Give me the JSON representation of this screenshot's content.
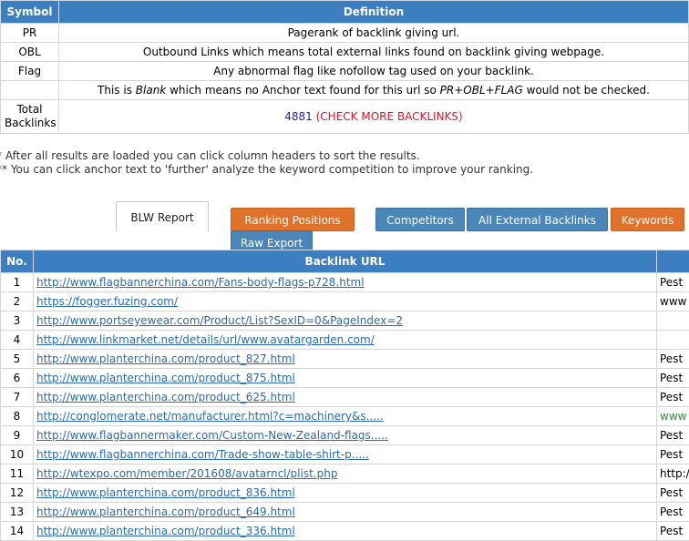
{
  "legend": {
    "headers": {
      "symbol": "Symbol",
      "definition": "Definition"
    },
    "rows": [
      {
        "symbol": "PR",
        "definition": "Pagerank of backlink giving url."
      },
      {
        "symbol": "OBL",
        "definition": "Outbound Links which means total external links found on backlink giving webpage."
      },
      {
        "symbol": "Flag",
        "definition": "Any abnormal flag like nofollow tag used on your backlink."
      }
    ],
    "blank_row": {
      "symbol": "",
      "pre": "This is ",
      "blank": "Blank",
      "mid": " which means no Anchor text found for this url so ",
      "formula": "PR+OBL+FLAG",
      "post": " would not be checked."
    },
    "total": {
      "label_line1": "Total",
      "label_line2": "Backlinks",
      "count": "4881",
      "link": "(CHECK MORE BACKLINKS)"
    }
  },
  "notes": [
    "* After all results are loaded you can click column headers to sort the results.",
    "** You can click anchor text to 'further' analyze the keyword competition to improve your ranking."
  ],
  "tabs": {
    "blw": "BLW Report",
    "ranking": "Ranking Positions",
    "competitors": "Competitors",
    "external": "All External Backlinks",
    "keywords": "Keywords",
    "raw": "Raw Export"
  },
  "results": {
    "headers": {
      "no": "No.",
      "url": "Backlink URL",
      "anchor": ""
    },
    "rows": [
      {
        "no": "1",
        "url": "http://www.flagbannerchina.com/Fans-body-flags-p728.html",
        "anchor": "Pest"
      },
      {
        "no": "2",
        "url": "https://fogger.fuzing.com/",
        "anchor": "www"
      },
      {
        "no": "3",
        "url": "http://www.portseyewear.com/Product/List?SexID=0&PageIndex=2",
        "anchor": ""
      },
      {
        "no": "4",
        "url": "http://www.linkmarket.net/details/url/www.avatargarden.com/",
        "anchor": ""
      },
      {
        "no": "5",
        "url": "http://www.planterchina.com/product_827.html",
        "anchor": "Pest"
      },
      {
        "no": "6",
        "url": "http://www.planterchina.com/product_875.html",
        "anchor": "Pest"
      },
      {
        "no": "7",
        "url": "http://www.planterchina.com/product_625.html",
        "anchor": "Pest"
      },
      {
        "no": "8",
        "url": "http://conglomerate.net/manufacturer.html?c=machinery&s.....",
        "anchor": "www"
      },
      {
        "no": "9",
        "url": "http://www.flagbannermaker.com/Custom-New-Zealand-flags.....",
        "anchor": "Pest"
      },
      {
        "no": "10",
        "url": "http://www.flagbannerchina.com/Trade-show-table-shirt-p.....",
        "anchor": "Pest"
      },
      {
        "no": "11",
        "url": "http://wtexpo.com/member/201608/avatarncl/plist.php",
        "anchor": "http:/"
      },
      {
        "no": "12",
        "url": "http://www.planterchina.com/product_836.html",
        "anchor": "Pest"
      },
      {
        "no": "13",
        "url": "http://www.planterchina.com/product_649.html",
        "anchor": "Pest"
      },
      {
        "no": "14",
        "url": "http://www.planterchina.com/product_336.html",
        "anchor": "Pest"
      }
    ]
  }
}
